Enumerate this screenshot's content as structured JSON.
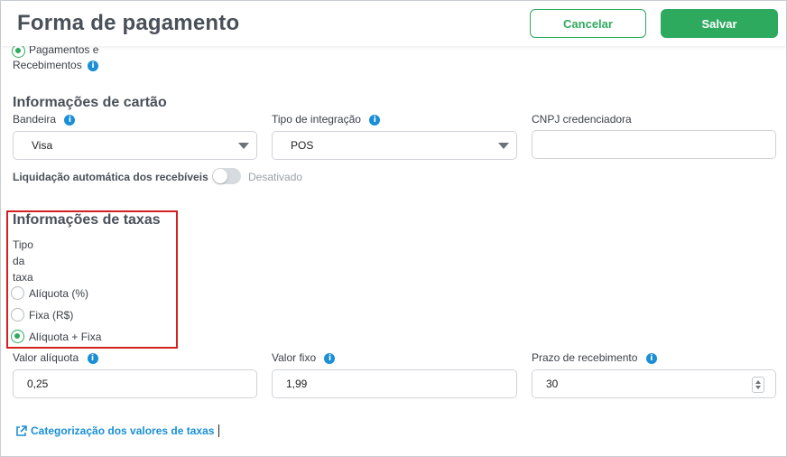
{
  "header": {
    "title": "Forma de pagamento",
    "cancel_label": "Cancelar",
    "save_label": "Salvar"
  },
  "top_option": {
    "line1": "Pagamentos e",
    "line2": "Recebimentos",
    "selected": true
  },
  "card_section": {
    "title": "Informações de cartão",
    "bandeira": {
      "label": "Bandeira",
      "value": "Visa"
    },
    "tipo_integracao": {
      "label": "Tipo de integração",
      "value": "POS"
    },
    "cnpj": {
      "label": "CNPJ credenciadora",
      "value": ""
    },
    "liquidacao": {
      "label": "Liquidação automática dos recebíveis",
      "state_label": "Desativado",
      "enabled": false
    }
  },
  "tax_section": {
    "title": "Informações de taxas",
    "tipo_label": {
      "line1": "Tipo",
      "line2": "da",
      "line3": "taxa"
    },
    "options": [
      {
        "label": "Alíquota (%)",
        "selected": false
      },
      {
        "label": "Fixa (R$)",
        "selected": false
      },
      {
        "label": "Alíquota + Fixa",
        "selected": true
      }
    ],
    "valor_aliquota": {
      "label": "Valor alíquota",
      "value": "0,25"
    },
    "valor_fixo": {
      "label": "Valor fixo",
      "value": "1,99"
    },
    "prazo": {
      "label": "Prazo de recebimento",
      "value": "30"
    }
  },
  "link": {
    "label": "Categorização dos valores de taxas"
  },
  "icons": {
    "info": "info-icon",
    "external_link": "external-link-icon"
  },
  "colors": {
    "accent_green": "#2eaa5f",
    "info_blue": "#1a8fd6",
    "highlight_red": "#d42020"
  }
}
